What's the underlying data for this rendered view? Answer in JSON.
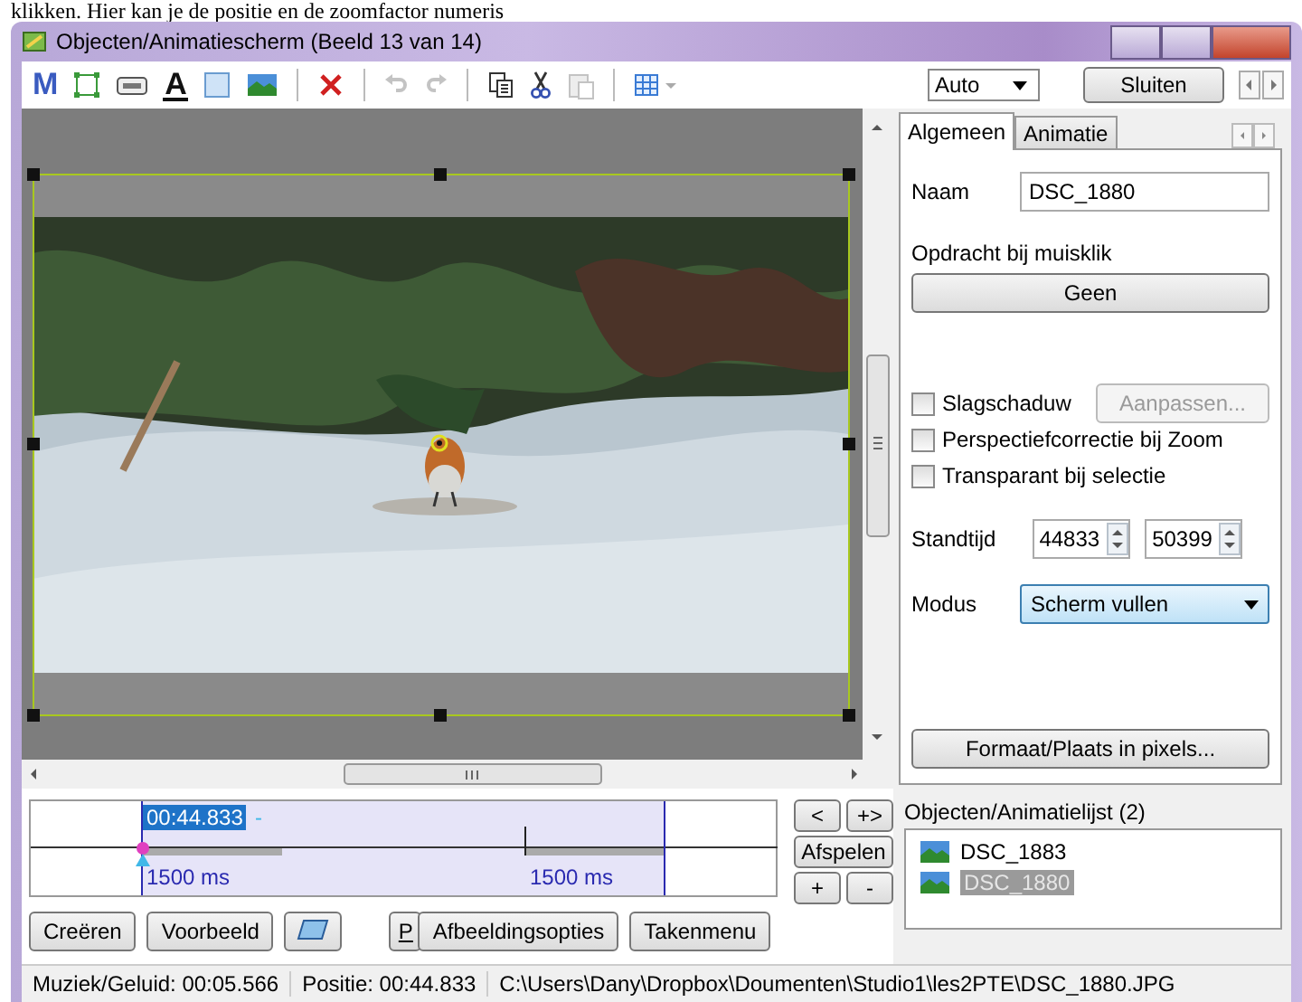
{
  "document_text": "klikken. Hier kan je de positie en de zoomfactor numeris",
  "window": {
    "title": "Objecten/Animatiescherm  (Beeld 13 van 14)"
  },
  "toolbar": [
    {
      "kind": "text-tool",
      "label": "M",
      "disabled": false
    },
    {
      "kind": "frame-tool",
      "disabled": false
    },
    {
      "kind": "button-tool",
      "disabled": false
    },
    {
      "kind": "font-tool",
      "label": "A",
      "disabled": false
    },
    {
      "kind": "rect-tool",
      "disabled": false
    },
    {
      "kind": "image-tool",
      "disabled": false
    },
    {
      "kind": "delete",
      "disabled": false
    },
    {
      "kind": "undo",
      "disabled": true
    },
    {
      "kind": "redo",
      "disabled": true
    },
    {
      "kind": "copy",
      "disabled": false
    },
    {
      "kind": "cut",
      "disabled": false
    },
    {
      "kind": "paste",
      "disabled": true
    },
    {
      "kind": "grid",
      "disabled": false
    }
  ],
  "zoom_select": "Auto",
  "close_button": "Sluiten",
  "tabs": [
    {
      "label": "Algemeen",
      "selected": true
    },
    {
      "label": "Animatie",
      "selected": false
    }
  ],
  "properties": {
    "name_label": "Naam",
    "name_value": "DSC_1880",
    "click_label": "Opdracht bij muisklik",
    "click_button": "Geen",
    "checkboxes": [
      {
        "label": "Slagschaduw",
        "checked": false
      },
      {
        "label": "Perspectiefcorrectie bij Zoom",
        "checked": false
      },
      {
        "label": "Transparant bij selectie",
        "checked": false
      }
    ],
    "adjust_button": {
      "label": "Aanpassen...",
      "disabled": true
    },
    "duration_label": "Standtijd",
    "duration_values": [
      "44833",
      "50399"
    ],
    "mode_label": "Modus",
    "mode_value": "Scherm vullen",
    "size_button": "Formaat/Plaats in pixels..."
  },
  "timeline": {
    "current_time": "00:44.833",
    "marker": "-",
    "labels": [
      "1500 ms",
      "1500 ms"
    ]
  },
  "timeline_buttons": [
    "<",
    "+>",
    "Afspelen",
    "+",
    "-"
  ],
  "bottom_buttons": [
    {
      "kind": "text",
      "label": "Creëren"
    },
    {
      "kind": "text",
      "label": "Voorbeeld"
    },
    {
      "kind": "icon"
    },
    {
      "kind": "text",
      "label": "P"
    },
    {
      "kind": "text",
      "label": "Afbeeldingsopties"
    },
    {
      "kind": "text",
      "label": "Takenmenu"
    }
  ],
  "object_list": {
    "title": "Objecten/Animatielijst (2)",
    "items": [
      {
        "label": "DSC_1883",
        "selected": false
      },
      {
        "label": "DSC_1880",
        "selected": true
      }
    ]
  },
  "status_bar": [
    "Muziek/Geluid: 00:05.566",
    "Positie: 00:44.833",
    "C:\\Users\\Dany\\Dropbox\\Doumenten\\Studio1\\les2PTE\\DSC_1880.JPG"
  ]
}
